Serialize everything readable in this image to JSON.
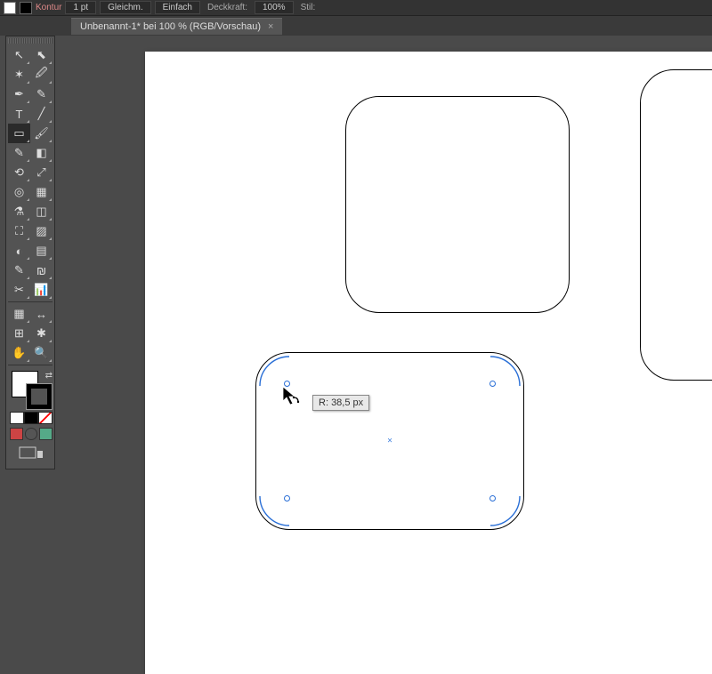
{
  "controlbar": {
    "tool_label": "",
    "kontur_label": "Kontur",
    "weight": "1 pt",
    "gleichm": "Gleichm.",
    "einfach": "Einfach",
    "deckkraft_label": "Deckkraft:",
    "deckkraft_value": "100%",
    "stil_label": "Stil:"
  },
  "tab": {
    "title": "Unbenannt-1* bei 100 % (RGB/Vorschau)",
    "close": "×"
  },
  "tools": {
    "row1a": "↖",
    "row1b": "⬉",
    "row2a": "✶",
    "row2b": "🖉",
    "row3a": "✒",
    "row3b": "✎",
    "row4a": "T",
    "row4b": "╱",
    "row5a": "▭",
    "row5b": "🖌",
    "row6a": "✎",
    "row6b": "◧",
    "row7a": "⟲",
    "row7b": "⤢",
    "row8a": "◎",
    "row8b": "▦",
    "row9a": "⚗",
    "row9b": "◫",
    "row10a": "⛶",
    "row10b": "▨",
    "row11a": "◐",
    "row11b": "▤",
    "row12a": "✎",
    "row12b": "₪",
    "row13a": "✂",
    "row13b": "📊",
    "row14a": "▦",
    "row14b": "↔",
    "row15a": "⊞",
    "row15b": "✱",
    "row16a": "✋",
    "row16b": "🔍"
  },
  "tooltip": {
    "label": "R:",
    "value": "38,5 px"
  },
  "shapes": {
    "selected_center": "×"
  }
}
